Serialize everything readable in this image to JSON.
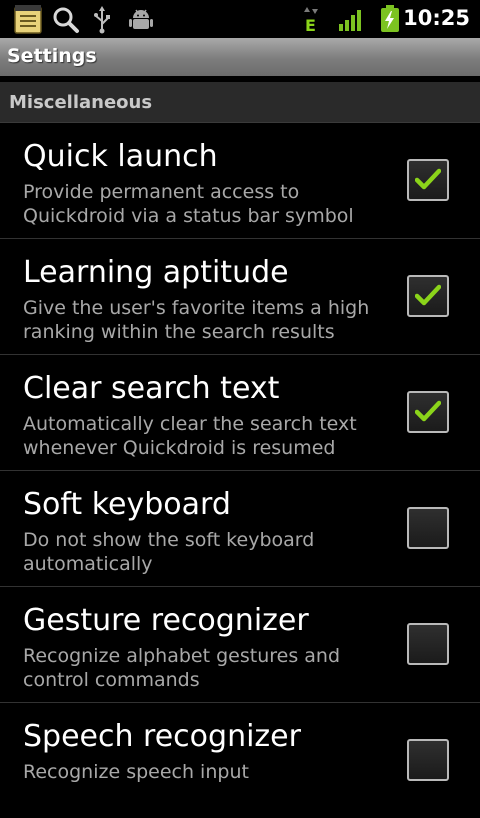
{
  "status_bar": {
    "time": "10:25",
    "icons": [
      "notes-icon",
      "search-icon",
      "usb-icon",
      "android-debug-icon",
      "edge-data-icon",
      "signal-icon",
      "battery-charging-icon"
    ],
    "network_label": "E"
  },
  "header": {
    "title": "Settings"
  },
  "category": {
    "label": "Miscellaneous"
  },
  "preferences": [
    {
      "title": "Quick launch",
      "summary": "Provide permanent access to Quickdroid via a status bar symbol",
      "checked": true
    },
    {
      "title": "Learning aptitude",
      "summary": "Give the user's favorite items a high ranking within the search results",
      "checked": true
    },
    {
      "title": "Clear search text",
      "summary": "Automatically clear the search text whenever Quickdroid is resumed",
      "checked": true
    },
    {
      "title": "Soft keyboard",
      "summary": "Do not show the soft keyboard automatically",
      "checked": false
    },
    {
      "title": "Gesture recognizer",
      "summary": "Recognize alphabet gestures and control commands",
      "checked": false
    },
    {
      "title": "Speech recognizer",
      "summary": "Recognize speech input",
      "checked": false
    }
  ],
  "colors": {
    "check_green": "#8bd41a",
    "signal_green": "#7cc321"
  }
}
